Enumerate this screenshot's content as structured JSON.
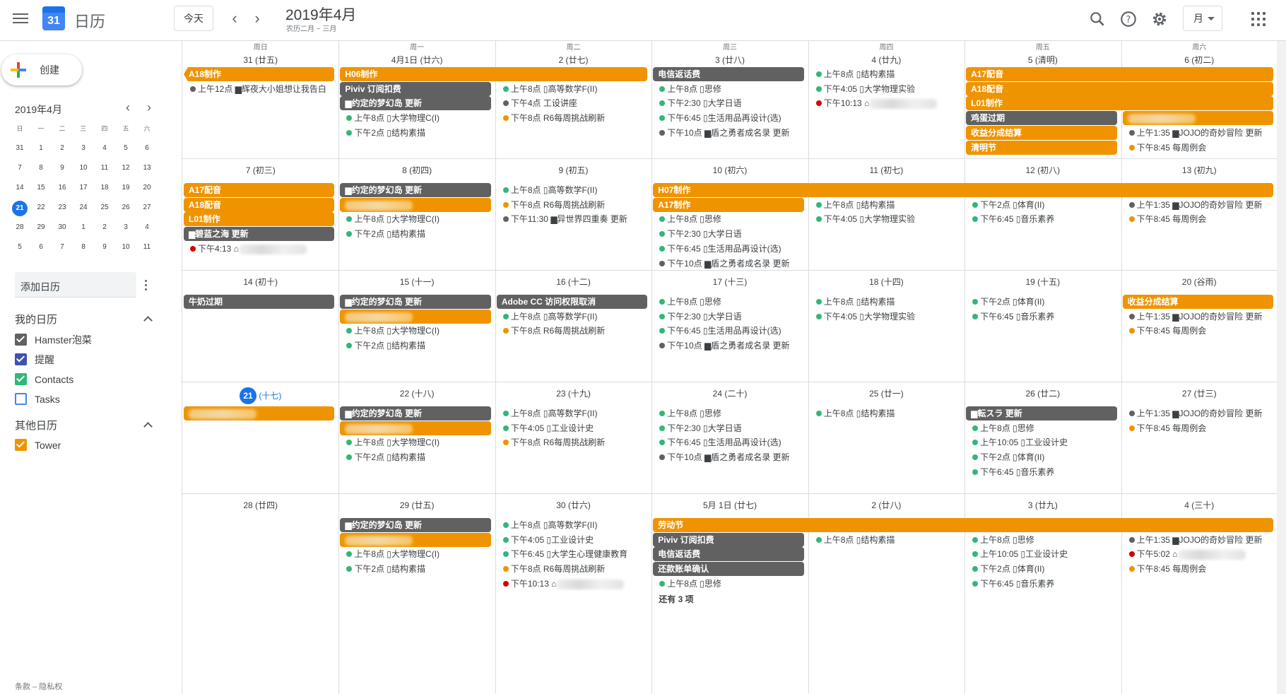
{
  "header": {
    "app_title": "日历",
    "logo_day": "31",
    "today_label": "今天",
    "prev_icon": "chevron-left-icon",
    "next_icon": "chevron-right-icon",
    "month_title": "2019年4月",
    "lunar_subtitle": "农历二月 ~ 三月",
    "view_label": "月",
    "icons": [
      "search-icon",
      "help-icon",
      "settings-icon",
      "apps-grid-icon"
    ]
  },
  "sidebar": {
    "create_label": "创建",
    "mini_title": "2019年4月",
    "mini_weekdays": [
      "日",
      "一",
      "二",
      "三",
      "四",
      "五",
      "六"
    ],
    "mini_weeks": [
      [
        "31",
        "1",
        "2",
        "3",
        "4",
        "5",
        "6"
      ],
      [
        "7",
        "8",
        "9",
        "10",
        "11",
        "12",
        "13"
      ],
      [
        "14",
        "15",
        "16",
        "17",
        "18",
        "19",
        "20"
      ],
      [
        "21",
        "22",
        "23",
        "24",
        "25",
        "26",
        "27"
      ],
      [
        "28",
        "29",
        "30",
        "1",
        "2",
        "3",
        "4"
      ],
      [
        "5",
        "6",
        "7",
        "8",
        "9",
        "10",
        "11"
      ]
    ],
    "mini_selected": "21",
    "add_calendar_placeholder": "添加日历",
    "my_calendars_title": "我的日历",
    "my_calendars": [
      {
        "label": "Hamster泡菜",
        "color": "#616161"
      },
      {
        "label": "提醒",
        "color": "#3f51b5"
      },
      {
        "label": "Contacts",
        "color": "#33b679"
      },
      {
        "label": "Tasks",
        "color": "#4285f4",
        "unchecked": true
      }
    ],
    "other_calendars_title": "其他日历",
    "other_calendars": [
      {
        "label": "Tower",
        "color": "#ef9400"
      }
    ],
    "footer": "条款 – 隐私权"
  },
  "colors": {
    "orange": "#ef9400",
    "gray": "#616161",
    "green": "#33b679",
    "red": "#d50000",
    "dark": "#616161",
    "blue": "#1a73e8"
  },
  "weekdays": [
    "周日",
    "周一",
    "周二",
    "周三",
    "周四",
    "周五",
    "周六"
  ],
  "weeks": [
    {
      "days": [
        "31 (廿五)",
        "4月1日 (廿六)",
        "2 (廿七)",
        "3 (廿八)",
        "4 (廿九)",
        "5 (清明)",
        "6 (初二)"
      ],
      "bars": [
        {
          "text": "A18制作",
          "c": 0,
          "span": 1,
          "row": 0,
          "color": "orange",
          "cut": true
        },
        {
          "text": "H06制作",
          "c": 1,
          "span": 2,
          "row": 0,
          "color": "orange"
        },
        {
          "text": "Piviv 订阅扣费",
          "c": 1,
          "span": 1,
          "row": 1,
          "color": "gray"
        },
        {
          "text": "▆约定的梦幻岛 更新",
          "c": 1,
          "span": 1,
          "row": 2,
          "color": "gray"
        },
        {
          "text": "电信返话费",
          "c": 3,
          "span": 1,
          "row": 0,
          "color": "gray"
        },
        {
          "text": "A17配音",
          "c": 5,
          "span": 2,
          "row": 0,
          "color": "orange"
        },
        {
          "text": "A18配音",
          "c": 5,
          "span": 2,
          "row": 1,
          "color": "orange"
        },
        {
          "text": "L01制作",
          "c": 5,
          "span": 2,
          "row": 2,
          "color": "orange"
        },
        {
          "text": "鸡蛋过期",
          "c": 5,
          "span": 1,
          "row": 3,
          "color": "gray"
        },
        {
          "text": "收益分成结算",
          "c": 5,
          "span": 1,
          "row": 4,
          "color": "orange"
        },
        {
          "text": "清明节",
          "c": 5,
          "span": 1,
          "row": 5,
          "color": "orange"
        },
        {
          "text": "",
          "c": 6,
          "span": 1,
          "row": 3,
          "color": "orange",
          "blur": true
        }
      ],
      "events": [
        {
          "c": 0,
          "row": 1,
          "dot": "dark",
          "text": "上午12点 ▆辉夜大小姐想让我告白"
        },
        {
          "c": 1,
          "row": 3,
          "dot": "green",
          "text": "上午8点 ▯大学物理C(I)"
        },
        {
          "c": 1,
          "row": 4,
          "dot": "green",
          "text": "下午2点 ▯结构素描"
        },
        {
          "c": 2,
          "row": 1,
          "dot": "green",
          "text": "上午8点 ▯高等数学F(II)"
        },
        {
          "c": 2,
          "row": 2,
          "dot": "dark",
          "text": "下午4点 工设讲座"
        },
        {
          "c": 2,
          "row": 3,
          "dot": "orange",
          "text": "下午8点 R6每周挑战刷新"
        },
        {
          "c": 3,
          "row": 1,
          "dot": "green",
          "text": "上午8点 ▯思修"
        },
        {
          "c": 3,
          "row": 2,
          "dot": "green",
          "text": "下午2:30 ▯大学日语"
        },
        {
          "c": 3,
          "row": 3,
          "dot": "green",
          "text": "下午6:45 ▯生活用品再设计(选)"
        },
        {
          "c": 3,
          "row": 4,
          "dot": "dark",
          "text": "下午10点 ▆盾之勇者成名录 更新"
        },
        {
          "c": 4,
          "row": 0,
          "dot": "green",
          "text": "上午8点 ▯结构素描"
        },
        {
          "c": 4,
          "row": 1,
          "dot": "green",
          "text": "下午4:05 ▯大学物理实验"
        },
        {
          "c": 4,
          "row": 2,
          "dot": "red",
          "text": "下午10:13 ⌂",
          "blur": true
        },
        {
          "c": 6,
          "row": 4,
          "dot": "dark",
          "text": "上午1:35 ▆JOJO的奇妙冒险 更新"
        },
        {
          "c": 6,
          "row": 5,
          "dot": "orange",
          "text": "下午8:45 每周例会"
        }
      ]
    },
    {
      "days": [
        "7 (初三)",
        "8 (初四)",
        "9 (初五)",
        "10 (初六)",
        "11 (初七)",
        "12 (初八)",
        "13 (初九)"
      ],
      "bars": [
        {
          "text": "A17配音",
          "c": 0,
          "span": 1,
          "row": 0,
          "color": "orange"
        },
        {
          "text": "A18配音",
          "c": 0,
          "span": 1,
          "row": 1,
          "color": "orange"
        },
        {
          "text": "L01制作",
          "c": 0,
          "span": 1,
          "row": 2,
          "color": "orange"
        },
        {
          "text": "▆碧蓝之海 更新",
          "c": 0,
          "span": 1,
          "row": 3,
          "color": "gray"
        },
        {
          "text": "▆约定的梦幻岛 更新",
          "c": 1,
          "span": 1,
          "row": 0,
          "color": "gray"
        },
        {
          "text": "",
          "c": 1,
          "span": 1,
          "row": 1,
          "color": "orange",
          "blur": true
        },
        {
          "text": "H07制作",
          "c": 3,
          "span": 4,
          "row": 0,
          "color": "orange"
        },
        {
          "text": "A17制作",
          "c": 3,
          "span": 1,
          "row": 1,
          "color": "orange"
        }
      ],
      "events": [
        {
          "c": 0,
          "row": 4,
          "dot": "red",
          "text": "下午4:13 ⌂",
          "blur": true
        },
        {
          "c": 1,
          "row": 2,
          "dot": "green",
          "text": "上午8点 ▯大学物理C(I)"
        },
        {
          "c": 1,
          "row": 3,
          "dot": "green",
          "text": "下午2点 ▯结构素描"
        },
        {
          "c": 2,
          "row": 0,
          "dot": "green",
          "text": "上午8点 ▯高等数学F(II)"
        },
        {
          "c": 2,
          "row": 1,
          "dot": "orange",
          "text": "下午8点 R6每周挑战刷新"
        },
        {
          "c": 2,
          "row": 2,
          "dot": "dark",
          "text": "下午11:30 ▆异世界四重奏 更新"
        },
        {
          "c": 3,
          "row": 2,
          "dot": "green",
          "text": "上午8点 ▯思修"
        },
        {
          "c": 3,
          "row": 3,
          "dot": "green",
          "text": "下午2:30 ▯大学日语"
        },
        {
          "c": 3,
          "row": 4,
          "dot": "green",
          "text": "下午6:45 ▯生活用品再设计(选)"
        },
        {
          "c": 3,
          "row": 5,
          "dot": "dark",
          "text": "下午10点 ▆盾之勇者成名录 更新"
        },
        {
          "c": 4,
          "row": 1,
          "dot": "green",
          "text": "上午8点 ▯结构素描"
        },
        {
          "c": 4,
          "row": 2,
          "dot": "green",
          "text": "下午4:05 ▯大学物理实验"
        },
        {
          "c": 5,
          "row": 1,
          "dot": "green",
          "text": "下午2点 ▯体育(II)"
        },
        {
          "c": 5,
          "row": 2,
          "dot": "green",
          "text": "下午6:45 ▯音乐素养"
        },
        {
          "c": 6,
          "row": 1,
          "dot": "dark",
          "text": "上午1:35 ▆JOJO的奇妙冒险 更新"
        },
        {
          "c": 6,
          "row": 2,
          "dot": "orange",
          "text": "下午8:45 每周例会"
        }
      ]
    },
    {
      "days": [
        "14 (初十)",
        "15 (十一)",
        "16 (十二)",
        "17 (十三)",
        "18 (十四)",
        "19 (十五)",
        "20 (谷雨)"
      ],
      "bars": [
        {
          "text": "牛奶过期",
          "c": 0,
          "span": 1,
          "row": 0,
          "color": "gray"
        },
        {
          "text": "▆约定的梦幻岛 更新",
          "c": 1,
          "span": 1,
          "row": 0,
          "color": "gray"
        },
        {
          "text": "",
          "c": 1,
          "span": 1,
          "row": 1,
          "color": "orange",
          "blur": true
        },
        {
          "text": "Adobe CC 访问权限取消",
          "c": 2,
          "span": 1,
          "row": 0,
          "color": "gray"
        },
        {
          "text": "收益分成结算",
          "c": 6,
          "span": 1,
          "row": 0,
          "color": "orange"
        }
      ],
      "events": [
        {
          "c": 1,
          "row": 2,
          "dot": "green",
          "text": "上午8点 ▯大学物理C(I)"
        },
        {
          "c": 1,
          "row": 3,
          "dot": "green",
          "text": "下午2点 ▯结构素描"
        },
        {
          "c": 2,
          "row": 1,
          "dot": "green",
          "text": "上午8点 ▯高等数学F(II)"
        },
        {
          "c": 2,
          "row": 2,
          "dot": "orange",
          "text": "下午8点 R6每周挑战刷新"
        },
        {
          "c": 3,
          "row": 0,
          "dot": "green",
          "text": "上午8点 ▯思修"
        },
        {
          "c": 3,
          "row": 1,
          "dot": "green",
          "text": "下午2:30 ▯大学日语"
        },
        {
          "c": 3,
          "row": 2,
          "dot": "green",
          "text": "下午6:45 ▯生活用品再设计(选)"
        },
        {
          "c": 3,
          "row": 3,
          "dot": "dark",
          "text": "下午10点 ▆盾之勇者成名录 更新"
        },
        {
          "c": 4,
          "row": 0,
          "dot": "green",
          "text": "上午8点 ▯结构素描"
        },
        {
          "c": 4,
          "row": 1,
          "dot": "green",
          "text": "下午4:05 ▯大学物理实验"
        },
        {
          "c": 5,
          "row": 0,
          "dot": "green",
          "text": "下午2点 ▯体育(II)"
        },
        {
          "c": 5,
          "row": 1,
          "dot": "green",
          "text": "下午6:45 ▯音乐素养"
        },
        {
          "c": 6,
          "row": 1,
          "dot": "dark",
          "text": "上午1:35 ▆JOJO的奇妙冒险 更新"
        },
        {
          "c": 6,
          "row": 2,
          "dot": "orange",
          "text": "下午8:45 每周例会"
        }
      ]
    },
    {
      "days": [
        "21 (十七)",
        "22 (十八)",
        "23 (十九)",
        "24 (二十)",
        "25 (廿一)",
        "26 (廿二)",
        "27 (廿三)"
      ],
      "today_col": 0,
      "bars": [
        {
          "text": "",
          "c": 0,
          "span": 1,
          "row": 0,
          "color": "orange",
          "blur": true
        },
        {
          "text": "▆约定的梦幻岛 更新",
          "c": 1,
          "span": 1,
          "row": 0,
          "color": "gray"
        },
        {
          "text": "",
          "c": 1,
          "span": 1,
          "row": 1,
          "color": "orange",
          "blur": true
        },
        {
          "text": "▆転スラ 更新",
          "c": 5,
          "span": 1,
          "row": 0,
          "color": "gray"
        }
      ],
      "events": [
        {
          "c": 1,
          "row": 2,
          "dot": "green",
          "text": "上午8点 ▯大学物理C(I)"
        },
        {
          "c": 1,
          "row": 3,
          "dot": "green",
          "text": "下午2点 ▯结构素描"
        },
        {
          "c": 2,
          "row": 0,
          "dot": "green",
          "text": "上午8点 ▯高等数学F(II)"
        },
        {
          "c": 2,
          "row": 1,
          "dot": "green",
          "text": "下午4:05 ▯工业设计史"
        },
        {
          "c": 2,
          "row": 2,
          "dot": "orange",
          "text": "下午8点 R6每周挑战刷新"
        },
        {
          "c": 3,
          "row": 0,
          "dot": "green",
          "text": "上午8点 ▯思修"
        },
        {
          "c": 3,
          "row": 1,
          "dot": "green",
          "text": "下午2:30 ▯大学日语"
        },
        {
          "c": 3,
          "row": 2,
          "dot": "green",
          "text": "下午6:45 ▯生活用品再设计(选)"
        },
        {
          "c": 3,
          "row": 3,
          "dot": "dark",
          "text": "下午10点 ▆盾之勇者成名录 更新"
        },
        {
          "c": 4,
          "row": 0,
          "dot": "green",
          "text": "上午8点 ▯结构素描"
        },
        {
          "c": 5,
          "row": 1,
          "dot": "green",
          "text": "上午8点 ▯思修"
        },
        {
          "c": 5,
          "row": 2,
          "dot": "green",
          "text": "上午10:05 ▯工业设计史"
        },
        {
          "c": 5,
          "row": 3,
          "dot": "green",
          "text": "下午2点 ▯体育(II)"
        },
        {
          "c": 5,
          "row": 4,
          "dot": "green",
          "text": "下午6:45 ▯音乐素养"
        },
        {
          "c": 6,
          "row": 0,
          "dot": "dark",
          "text": "上午1:35 ▆JOJO的奇妙冒险 更新"
        },
        {
          "c": 6,
          "row": 1,
          "dot": "orange",
          "text": "下午8:45 每周例会"
        }
      ]
    },
    {
      "days": [
        "28 (廿四)",
        "29 (廿五)",
        "30 (廿六)",
        "5月 1日 (廿七)",
        "2 (廿八)",
        "3 (廿九)",
        "4 (三十)"
      ],
      "bars": [
        {
          "text": "▆约定的梦幻岛 更新",
          "c": 1,
          "span": 1,
          "row": 0,
          "color": "gray"
        },
        {
          "text": "",
          "c": 1,
          "span": 1,
          "row": 1,
          "color": "orange",
          "blur": true
        },
        {
          "text": "劳动节",
          "c": 3,
          "span": 4,
          "row": 0,
          "color": "orange"
        },
        {
          "text": "Piviv 订阅扣费",
          "c": 3,
          "span": 1,
          "row": 1,
          "color": "gray"
        },
        {
          "text": "电信返话费",
          "c": 3,
          "span": 1,
          "row": 2,
          "color": "gray"
        },
        {
          "text": "还款账单确认",
          "c": 3,
          "span": 1,
          "row": 3,
          "color": "gray"
        }
      ],
      "events": [
        {
          "c": 1,
          "row": 2,
          "dot": "green",
          "text": "上午8点 ▯大学物理C(I)"
        },
        {
          "c": 1,
          "row": 3,
          "dot": "green",
          "text": "下午2点 ▯结构素描"
        },
        {
          "c": 2,
          "row": 0,
          "dot": "green",
          "text": "上午8点 ▯高等数学F(II)"
        },
        {
          "c": 2,
          "row": 1,
          "dot": "green",
          "text": "下午4:05 ▯工业设计史"
        },
        {
          "c": 2,
          "row": 2,
          "dot": "green",
          "text": "下午6:45 ▯大学生心理健康教育"
        },
        {
          "c": 2,
          "row": 3,
          "dot": "orange",
          "text": "下午8点 R6每周挑战刷新"
        },
        {
          "c": 2,
          "row": 4,
          "dot": "red",
          "text": "下午10:13 ⌂",
          "blur": true
        },
        {
          "c": 3,
          "row": 4,
          "dot": "green",
          "text": "上午8点 ▯思修"
        },
        {
          "c": 4,
          "row": 1,
          "dot": "green",
          "text": "上午8点 ▯结构素描"
        },
        {
          "c": 5,
          "row": 1,
          "dot": "green",
          "text": "上午8点 ▯思修"
        },
        {
          "c": 5,
          "row": 2,
          "dot": "green",
          "text": "上午10:05 ▯工业设计史"
        },
        {
          "c": 5,
          "row": 3,
          "dot": "green",
          "text": "下午2点 ▯体育(II)"
        },
        {
          "c": 5,
          "row": 4,
          "dot": "green",
          "text": "下午6:45 ▯音乐素养"
        },
        {
          "c": 6,
          "row": 1,
          "dot": "dark",
          "text": "上午1:35 ▆JOJO的奇妙冒险 更新"
        },
        {
          "c": 6,
          "row": 2,
          "dot": "red",
          "text": "下午5:02 ⌂",
          "blur": true
        },
        {
          "c": 6,
          "row": 3,
          "dot": "orange",
          "text": "下午8:45 每周例会"
        }
      ],
      "more": {
        "c": 3,
        "row": 5,
        "text": "还有 3 项"
      }
    }
  ]
}
